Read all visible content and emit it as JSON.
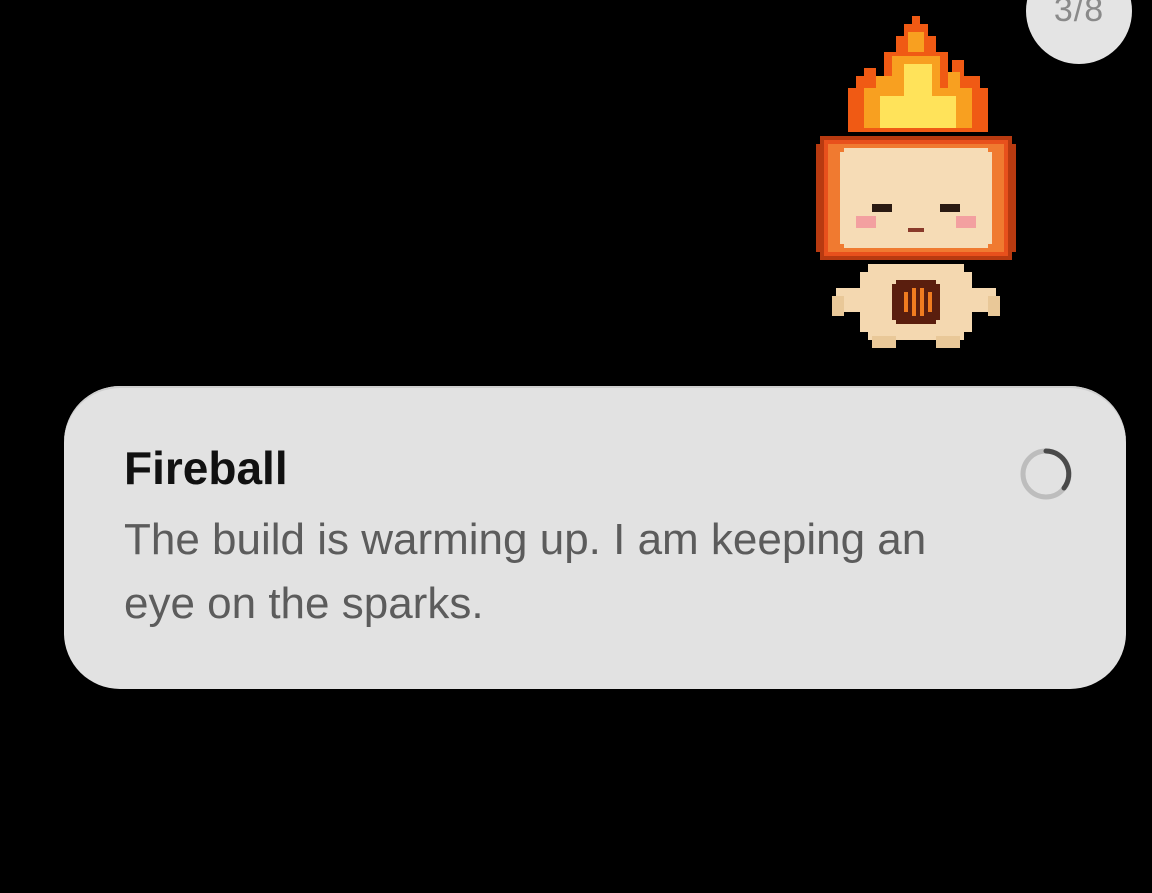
{
  "page_counter": {
    "text": "3/8"
  },
  "mascot": {
    "name_icon": "fireball-mascot-icon",
    "colors": {
      "flame_outer": "#f05a14",
      "flame_mid": "#f8a020",
      "flame_inner": "#ffe35a",
      "head_frame": "#e8501c",
      "head_frame_dark": "#b83a10",
      "face": "#f6dcb6",
      "cheek": "#f3a0a0",
      "body": "#f4d8b0",
      "core": "#5a1e0e",
      "core_glow": "#f07c20"
    }
  },
  "notification": {
    "title": "Fireball",
    "message": "The build is warming up. I am keeping an eye on the sparks.",
    "status_icon": "loading-spinner-icon",
    "background": "#e2e2e2"
  }
}
